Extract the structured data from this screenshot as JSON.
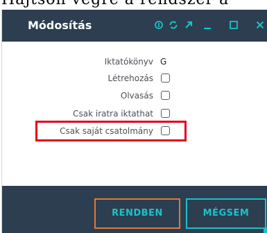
{
  "background_text": "Hajtson végre a rendszer a",
  "window": {
    "title": "Módosítás",
    "icons": [
      "info-icon",
      "refresh-icon",
      "expand-arrow-icon",
      "minimize-icon",
      "maximize-icon",
      "close-icon"
    ]
  },
  "form": {
    "rows": [
      {
        "label": "Iktatókönyv",
        "value": "G"
      },
      {
        "label": "Létrehozás",
        "checked": false
      },
      {
        "label": "Olvasás",
        "checked": false
      },
      {
        "label": "Csak iratra iktathat",
        "checked": false
      },
      {
        "label": "Csak saját csatolmány",
        "checked": false
      }
    ]
  },
  "buttons": {
    "ok_label": "RENDBEN",
    "cancel_label": "MÉGSEM"
  },
  "colors": {
    "header_bg": "#2c3e50",
    "accent": "#1cc2c9",
    "highlight": "#e0001b",
    "ok_border": "#e07a3a"
  }
}
